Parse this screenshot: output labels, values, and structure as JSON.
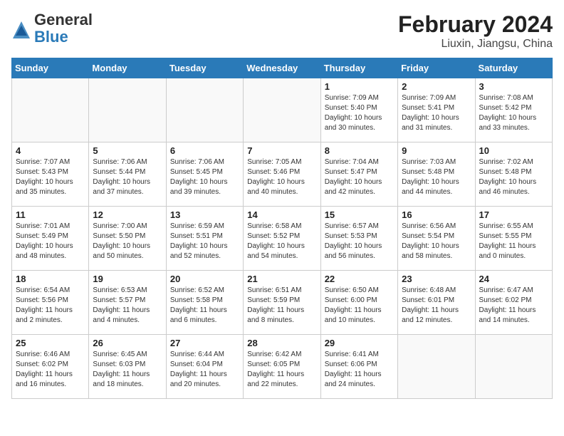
{
  "header": {
    "logo_line1": "General",
    "logo_line2": "Blue",
    "title": "February 2024",
    "subtitle": "Liuxin, Jiangsu, China"
  },
  "weekdays": [
    "Sunday",
    "Monday",
    "Tuesday",
    "Wednesday",
    "Thursday",
    "Friday",
    "Saturday"
  ],
  "weeks": [
    [
      {
        "day": "",
        "info": ""
      },
      {
        "day": "",
        "info": ""
      },
      {
        "day": "",
        "info": ""
      },
      {
        "day": "",
        "info": ""
      },
      {
        "day": "1",
        "info": "Sunrise: 7:09 AM\nSunset: 5:40 PM\nDaylight: 10 hours\nand 30 minutes."
      },
      {
        "day": "2",
        "info": "Sunrise: 7:09 AM\nSunset: 5:41 PM\nDaylight: 10 hours\nand 31 minutes."
      },
      {
        "day": "3",
        "info": "Sunrise: 7:08 AM\nSunset: 5:42 PM\nDaylight: 10 hours\nand 33 minutes."
      }
    ],
    [
      {
        "day": "4",
        "info": "Sunrise: 7:07 AM\nSunset: 5:43 PM\nDaylight: 10 hours\nand 35 minutes."
      },
      {
        "day": "5",
        "info": "Sunrise: 7:06 AM\nSunset: 5:44 PM\nDaylight: 10 hours\nand 37 minutes."
      },
      {
        "day": "6",
        "info": "Sunrise: 7:06 AM\nSunset: 5:45 PM\nDaylight: 10 hours\nand 39 minutes."
      },
      {
        "day": "7",
        "info": "Sunrise: 7:05 AM\nSunset: 5:46 PM\nDaylight: 10 hours\nand 40 minutes."
      },
      {
        "day": "8",
        "info": "Sunrise: 7:04 AM\nSunset: 5:47 PM\nDaylight: 10 hours\nand 42 minutes."
      },
      {
        "day": "9",
        "info": "Sunrise: 7:03 AM\nSunset: 5:48 PM\nDaylight: 10 hours\nand 44 minutes."
      },
      {
        "day": "10",
        "info": "Sunrise: 7:02 AM\nSunset: 5:48 PM\nDaylight: 10 hours\nand 46 minutes."
      }
    ],
    [
      {
        "day": "11",
        "info": "Sunrise: 7:01 AM\nSunset: 5:49 PM\nDaylight: 10 hours\nand 48 minutes."
      },
      {
        "day": "12",
        "info": "Sunrise: 7:00 AM\nSunset: 5:50 PM\nDaylight: 10 hours\nand 50 minutes."
      },
      {
        "day": "13",
        "info": "Sunrise: 6:59 AM\nSunset: 5:51 PM\nDaylight: 10 hours\nand 52 minutes."
      },
      {
        "day": "14",
        "info": "Sunrise: 6:58 AM\nSunset: 5:52 PM\nDaylight: 10 hours\nand 54 minutes."
      },
      {
        "day": "15",
        "info": "Sunrise: 6:57 AM\nSunset: 5:53 PM\nDaylight: 10 hours\nand 56 minutes."
      },
      {
        "day": "16",
        "info": "Sunrise: 6:56 AM\nSunset: 5:54 PM\nDaylight: 10 hours\nand 58 minutes."
      },
      {
        "day": "17",
        "info": "Sunrise: 6:55 AM\nSunset: 5:55 PM\nDaylight: 11 hours\nand 0 minutes."
      }
    ],
    [
      {
        "day": "18",
        "info": "Sunrise: 6:54 AM\nSunset: 5:56 PM\nDaylight: 11 hours\nand 2 minutes."
      },
      {
        "day": "19",
        "info": "Sunrise: 6:53 AM\nSunset: 5:57 PM\nDaylight: 11 hours\nand 4 minutes."
      },
      {
        "day": "20",
        "info": "Sunrise: 6:52 AM\nSunset: 5:58 PM\nDaylight: 11 hours\nand 6 minutes."
      },
      {
        "day": "21",
        "info": "Sunrise: 6:51 AM\nSunset: 5:59 PM\nDaylight: 11 hours\nand 8 minutes."
      },
      {
        "day": "22",
        "info": "Sunrise: 6:50 AM\nSunset: 6:00 PM\nDaylight: 11 hours\nand 10 minutes."
      },
      {
        "day": "23",
        "info": "Sunrise: 6:48 AM\nSunset: 6:01 PM\nDaylight: 11 hours\nand 12 minutes."
      },
      {
        "day": "24",
        "info": "Sunrise: 6:47 AM\nSunset: 6:02 PM\nDaylight: 11 hours\nand 14 minutes."
      }
    ],
    [
      {
        "day": "25",
        "info": "Sunrise: 6:46 AM\nSunset: 6:02 PM\nDaylight: 11 hours\nand 16 minutes."
      },
      {
        "day": "26",
        "info": "Sunrise: 6:45 AM\nSunset: 6:03 PM\nDaylight: 11 hours\nand 18 minutes."
      },
      {
        "day": "27",
        "info": "Sunrise: 6:44 AM\nSunset: 6:04 PM\nDaylight: 11 hours\nand 20 minutes."
      },
      {
        "day": "28",
        "info": "Sunrise: 6:42 AM\nSunset: 6:05 PM\nDaylight: 11 hours\nand 22 minutes."
      },
      {
        "day": "29",
        "info": "Sunrise: 6:41 AM\nSunset: 6:06 PM\nDaylight: 11 hours\nand 24 minutes."
      },
      {
        "day": "",
        "info": ""
      },
      {
        "day": "",
        "info": ""
      }
    ]
  ]
}
